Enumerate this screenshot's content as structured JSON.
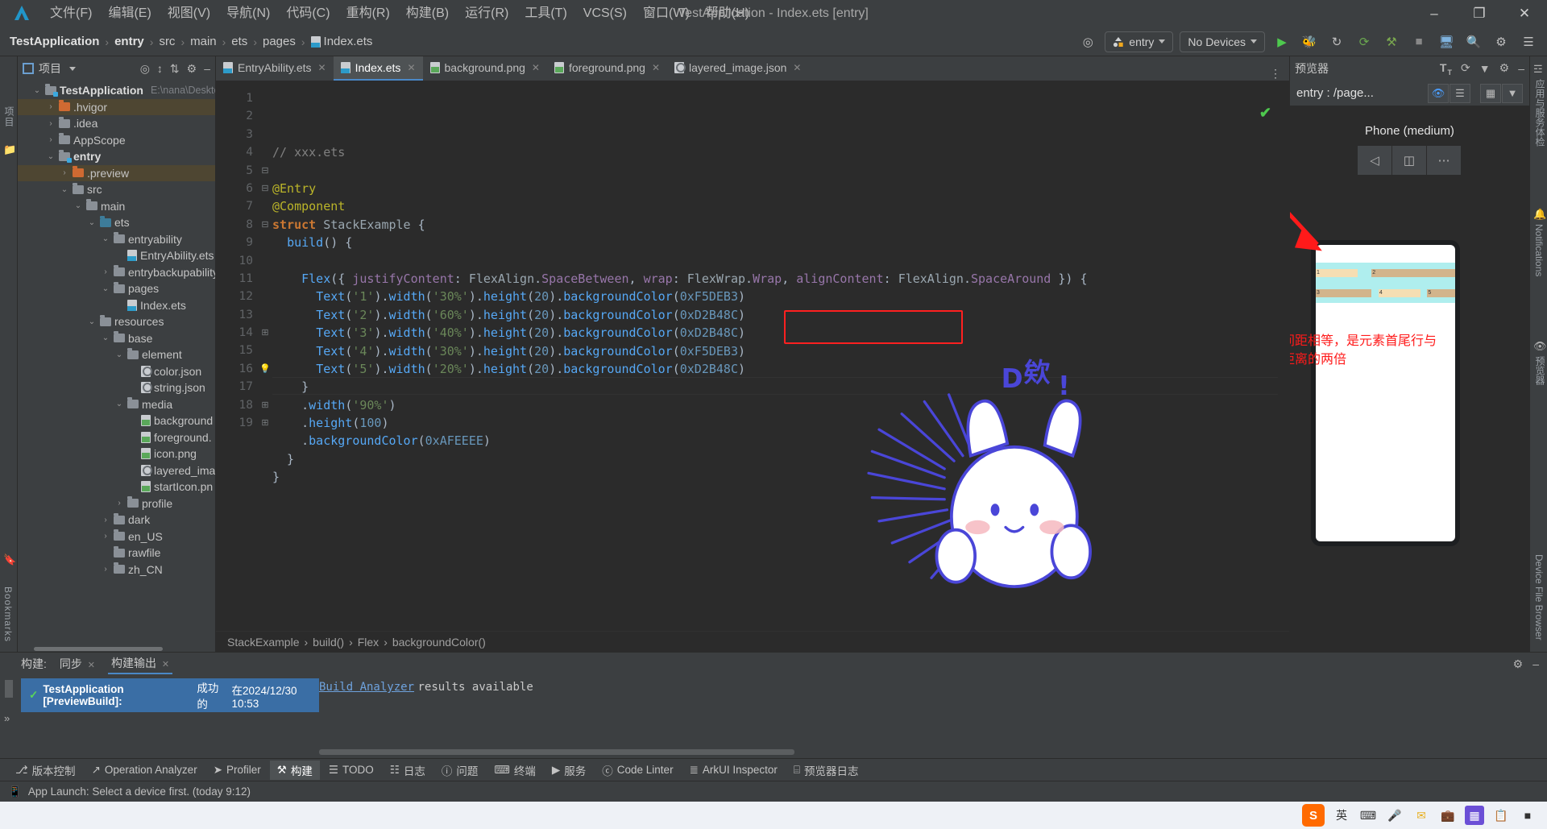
{
  "window": {
    "title": "TestApplication - Index.ets [entry]",
    "logo_icon": "deveco-logo-icon",
    "minimize": "–",
    "maximize": "❐",
    "close": "✕"
  },
  "menu": [
    {
      "label": "文件(F)"
    },
    {
      "label": "编辑(E)"
    },
    {
      "label": "视图(V)"
    },
    {
      "label": "导航(N)"
    },
    {
      "label": "代码(C)"
    },
    {
      "label": "重构(R)"
    },
    {
      "label": "构建(B)"
    },
    {
      "label": "运行(R)"
    },
    {
      "label": "工具(T)"
    },
    {
      "label": "VCS(S)"
    },
    {
      "label": "窗口(W)"
    },
    {
      "label": "帮助(H)"
    }
  ],
  "breadcrumb": {
    "items": [
      "TestApplication",
      "entry",
      "src",
      "main",
      "ets",
      "pages",
      "Index.ets"
    ],
    "separator": "›"
  },
  "navbar_right": {
    "target_icon": "target-icon",
    "run_config": "entry",
    "device": "No Devices",
    "icons": [
      "run-icon",
      "debug-icon",
      "profile-icon",
      "sync-icon",
      "attach-icon",
      "stop-icon",
      "device-manager-icon",
      "search-icon",
      "settings-icon",
      "notifications-icon"
    ]
  },
  "left_strip": {
    "project_label": "项目",
    "bookmarks_label": "Bookmarks"
  },
  "project_panel": {
    "title": "项目",
    "dropdown_icon": "chevron-down-icon",
    "tool_icons": [
      "locate-icon",
      "collapse-all-icon",
      "expand-icon",
      "settings-icon",
      "hide-icon"
    ],
    "tree": [
      {
        "depth": 0,
        "arrow": "v",
        "icon": "module-folder",
        "label": "TestApplication",
        "bold": true,
        "path": "E:\\nana\\Desktop",
        "state": "normal"
      },
      {
        "depth": 1,
        "arrow": ">",
        "icon": "orange-folder",
        "label": ".hvigor",
        "bold": false,
        "state": "highlight"
      },
      {
        "depth": 1,
        "arrow": ">",
        "icon": "gray-folder",
        "label": ".idea",
        "bold": false,
        "state": "normal"
      },
      {
        "depth": 1,
        "arrow": ">",
        "icon": "gray-folder",
        "label": "AppScope",
        "bold": false,
        "state": "normal"
      },
      {
        "depth": 1,
        "arrow": "v",
        "icon": "module-folder",
        "label": "entry",
        "bold": true,
        "state": "normal"
      },
      {
        "depth": 2,
        "arrow": ">",
        "icon": "orange-folder",
        "label": ".preview",
        "bold": false,
        "state": "highlight"
      },
      {
        "depth": 2,
        "arrow": "v",
        "icon": "gray-folder",
        "label": "src",
        "bold": false,
        "state": "normal"
      },
      {
        "depth": 3,
        "arrow": "v",
        "icon": "gray-folder",
        "label": "main",
        "bold": false,
        "state": "normal"
      },
      {
        "depth": 4,
        "arrow": "v",
        "icon": "blue-folder",
        "label": "ets",
        "bold": false,
        "state": "normal"
      },
      {
        "depth": 5,
        "arrow": "v",
        "icon": "gray-folder",
        "label": "entryability",
        "bold": false,
        "state": "normal"
      },
      {
        "depth": 6,
        "arrow": "",
        "icon": "ets-file",
        "label": "EntryAbility.ets",
        "bold": false,
        "state": "normal"
      },
      {
        "depth": 5,
        "arrow": ">",
        "icon": "gray-folder",
        "label": "entrybackupability",
        "bold": false,
        "state": "normal"
      },
      {
        "depth": 5,
        "arrow": "v",
        "icon": "gray-folder",
        "label": "pages",
        "bold": false,
        "state": "normal"
      },
      {
        "depth": 6,
        "arrow": "",
        "icon": "ets-file",
        "label": "Index.ets",
        "bold": false,
        "state": "normal"
      },
      {
        "depth": 4,
        "arrow": "v",
        "icon": "gray-folder",
        "label": "resources",
        "bold": false,
        "state": "normal"
      },
      {
        "depth": 5,
        "arrow": "v",
        "icon": "gray-folder",
        "label": "base",
        "bold": false,
        "state": "normal"
      },
      {
        "depth": 6,
        "arrow": "v",
        "icon": "gray-folder",
        "label": "element",
        "bold": false,
        "state": "normal"
      },
      {
        "depth": 7,
        "arrow": "",
        "icon": "json-file",
        "label": "color.json",
        "bold": false,
        "state": "normal"
      },
      {
        "depth": 7,
        "arrow": "",
        "icon": "json-file",
        "label": "string.json",
        "bold": false,
        "state": "normal"
      },
      {
        "depth": 6,
        "arrow": "v",
        "icon": "gray-folder",
        "label": "media",
        "bold": false,
        "state": "normal"
      },
      {
        "depth": 7,
        "arrow": "",
        "icon": "png-file",
        "label": "background",
        "bold": false,
        "state": "normal"
      },
      {
        "depth": 7,
        "arrow": "",
        "icon": "png-file",
        "label": "foreground.",
        "bold": false,
        "state": "normal"
      },
      {
        "depth": 7,
        "arrow": "",
        "icon": "png-file",
        "label": "icon.png",
        "bold": false,
        "state": "normal"
      },
      {
        "depth": 7,
        "arrow": "",
        "icon": "json-file",
        "label": "layered_ima",
        "bold": false,
        "state": "normal"
      },
      {
        "depth": 7,
        "arrow": "",
        "icon": "png-file",
        "label": "startIcon.pn",
        "bold": false,
        "state": "normal"
      },
      {
        "depth": 6,
        "arrow": ">",
        "icon": "gray-folder",
        "label": "profile",
        "bold": false,
        "state": "normal"
      },
      {
        "depth": 5,
        "arrow": ">",
        "icon": "gray-folder",
        "label": "dark",
        "bold": false,
        "state": "normal"
      },
      {
        "depth": 5,
        "arrow": ">",
        "icon": "gray-folder",
        "label": "en_US",
        "bold": false,
        "state": "normal"
      },
      {
        "depth": 5,
        "arrow": "",
        "icon": "gray-folder",
        "label": "rawfile",
        "bold": false,
        "state": "normal"
      },
      {
        "depth": 5,
        "arrow": ">",
        "icon": "gray-folder",
        "label": "zh_CN",
        "bold": false,
        "state": "normal"
      }
    ]
  },
  "editor": {
    "tabs": [
      {
        "label": "EntryAbility.ets",
        "icon": "ets-file-icon",
        "active": false
      },
      {
        "label": "Index.ets",
        "icon": "ets-file-icon",
        "active": true
      },
      {
        "label": "background.png",
        "icon": "png-file-icon",
        "active": false
      },
      {
        "label": "foreground.png",
        "icon": "png-file-icon",
        "active": false
      },
      {
        "label": "layered_image.json",
        "icon": "json-file-icon",
        "active": false
      }
    ],
    "more_icon": "more-tabs-icon",
    "line_numbers": [
      "1",
      "2",
      "3",
      "4",
      "5",
      "6",
      "7",
      "8",
      "9",
      "10",
      "11",
      "12",
      "13",
      "14",
      "15",
      "16",
      "17",
      "18",
      "19"
    ],
    "lines": [
      "// xxx.ets",
      "",
      "@Entry",
      "@Component",
      "struct StackExample {",
      "  build() {",
      "",
      "    Flex({ justifyContent: FlexAlign.SpaceBetween, wrap: FlexWrap.Wrap, alignContent: FlexAlign.SpaceAround }) {",
      "      Text('1').width('30%').height(20).backgroundColor(0xF5DEB3)",
      "      Text('2').width('60%').height(20).backgroundColor(0xD2B48C)",
      "      Text('3').width('40%').height(20).backgroundColor(0xD2B48C)",
      "      Text('4').width('30%').height(20).backgroundColor(0xF5DEB3)",
      "      Text('5').width('20%').height(20).backgroundColor(0xD2B48C)",
      "    }",
      "    .width('90%')",
      "    .height(100)",
      "    .backgroundColor(0xAFEEEE)",
      "  }",
      "}"
    ],
    "highlight_box_text": "FlexAlign.SpaceAround",
    "status_check_icon": "checkmark-icon",
    "bulb_icon": "lightbulb-icon",
    "footer_breadcrumb": [
      "StackExample",
      "build()",
      "Flex",
      "backgroundColor()"
    ]
  },
  "previewer": {
    "title": "预览器",
    "tool_icons": [
      "font-size-icon",
      "refresh-icon",
      "filter-icon",
      "settings-icon",
      "minimize-icon"
    ],
    "route": "entry : /page...",
    "inspect_icon": "inspect-icon",
    "layers_icon": "layers-icon",
    "grid_icon": "grid-icon",
    "chevron_icon": "chevron-down-icon",
    "device_label": "Phone (medium)",
    "device_buttons": [
      "rotate-left-icon",
      "multi-device-icon",
      "more-icon"
    ],
    "flex_items": [
      {
        "label": "1",
        "width_pct": 30,
        "color": "#F5DEB3"
      },
      {
        "label": "2",
        "width_pct": 60,
        "color": "#D2B48C"
      },
      {
        "label": "3",
        "width_pct": 40,
        "color": "#D2B48C"
      },
      {
        "label": "4",
        "width_pct": 30,
        "color": "#F5DEB3"
      },
      {
        "label": "5",
        "width_pct": 20,
        "color": "#D2B48C"
      }
    ],
    "container_color": "#AFEEEE"
  },
  "right_strip": {
    "app_services": "应用与服务体检",
    "notifications": "Notifications",
    "preview_label": "预览器",
    "device_file_browser": "Device File Browser"
  },
  "annotation": {
    "line1": "子元素各行间距相等，是元素首尾行与",
    "line2": "交叉轴两端距离的两倍",
    "color": "#ff1a1a"
  },
  "bottom_panel": {
    "label": "构建:",
    "tabs": [
      {
        "label": "同步",
        "active": false
      },
      {
        "label": "构建输出",
        "active": true
      }
    ],
    "tool_icons": [
      "settings-icon",
      "minimize-icon"
    ],
    "build_row": {
      "check_icon": "success-check-icon",
      "name": "TestApplication [PreviewBuild]:",
      "status": "成功的",
      "timestamp": "在2024/12/30 10:53"
    },
    "analyzer_link": "Build Analyzer",
    "analyzer_text": "results available",
    "expand_icon": "»"
  },
  "tool_windows": [
    {
      "label": "版本控制",
      "icon": "branch-icon",
      "active": false
    },
    {
      "label": "Operation Analyzer",
      "icon": "chart-icon",
      "active": false
    },
    {
      "label": "Profiler",
      "icon": "profiler-icon",
      "active": false
    },
    {
      "label": "构建",
      "icon": "build-hammer-icon",
      "active": true
    },
    {
      "label": "TODO",
      "icon": "todo-list-icon",
      "active": false
    },
    {
      "label": "日志",
      "icon": "log-icon",
      "active": false
    },
    {
      "label": "问题",
      "icon": "problems-icon",
      "active": false
    },
    {
      "label": "终端",
      "icon": "terminal-icon",
      "active": false
    },
    {
      "label": "服务",
      "icon": "services-icon",
      "active": false
    },
    {
      "label": "Code Linter",
      "icon": "linter-icon",
      "active": false
    },
    {
      "label": "ArkUI Inspector",
      "icon": "inspector-icon",
      "active": false
    },
    {
      "label": "预览器日志",
      "icon": "preview-log-icon",
      "active": false
    }
  ],
  "status_bar": {
    "icon": "device-icon",
    "message": "App Launch: Select a device first. (today 9:12)"
  },
  "taskbar": {
    "sogou_label": "S",
    "items": [
      "英",
      "keyboard-icon",
      "microphone-icon",
      "inbox-icon",
      "briefcase-icon",
      "grid-icon",
      "clipboard-icon",
      "battery-icon"
    ]
  }
}
